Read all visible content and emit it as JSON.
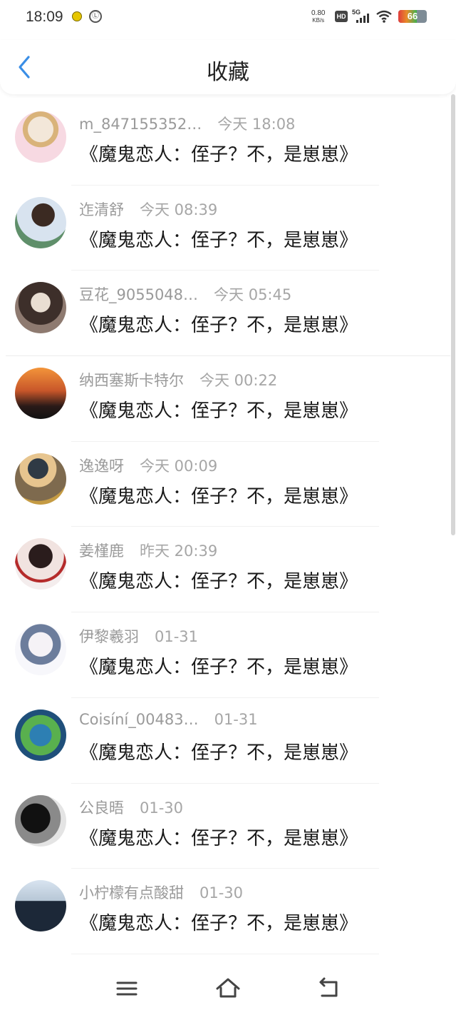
{
  "status_bar": {
    "time": "18:09",
    "speed_value": "0.80",
    "speed_unit": "KB/s",
    "hd_label": "HD",
    "network_label": "5G",
    "battery_level": "66",
    "icons": [
      "notification-icon",
      "vpn-icon",
      "signal-icon",
      "wifi-icon",
      "battery-icon"
    ]
  },
  "header": {
    "title": "收藏",
    "back_icon": "chevron-left-icon",
    "accent_color": "#3a8ee6"
  },
  "favorites": [
    {
      "user": "m_847155352…",
      "time": "今天 18:08",
      "title": "《魔鬼恋人：侄子？不，是崽崽》"
    },
    {
      "user": "迮清舒",
      "time": "今天 08:39",
      "title": "《魔鬼恋人：侄子？不，是崽崽》"
    },
    {
      "user": "豆花_9055048…",
      "time": "今天 05:45",
      "title": "《魔鬼恋人：侄子？不，是崽崽》"
    },
    {
      "user": "纳西塞斯卡特尔",
      "time": "今天 00:22",
      "title": "《魔鬼恋人：侄子？不，是崽崽》"
    },
    {
      "user": "逸逸呀",
      "time": "今天 00:09",
      "title": "《魔鬼恋人：侄子？不，是崽崽》"
    },
    {
      "user": "姜槿鹿",
      "time": "昨天 20:39",
      "title": "《魔鬼恋人：侄子？不，是崽崽》"
    },
    {
      "user": "伊黎羲羽",
      "time": "01-31",
      "title": "《魔鬼恋人：侄子？不，是崽崽》"
    },
    {
      "user": "Coisíní_00483…",
      "time": "01-31",
      "title": "《魔鬼恋人：侄子？不，是崽崽》"
    },
    {
      "user": "公良晤",
      "time": "01-30",
      "title": "《魔鬼恋人：侄子？不，是崽崽》"
    },
    {
      "user": "小柠檬有点酸甜",
      "time": "01-30",
      "title": "《魔鬼恋人：侄子？不，是崽崽》"
    }
  ],
  "bottom_nav": {
    "icons": [
      "menu-icon",
      "home-icon",
      "back-icon"
    ]
  }
}
